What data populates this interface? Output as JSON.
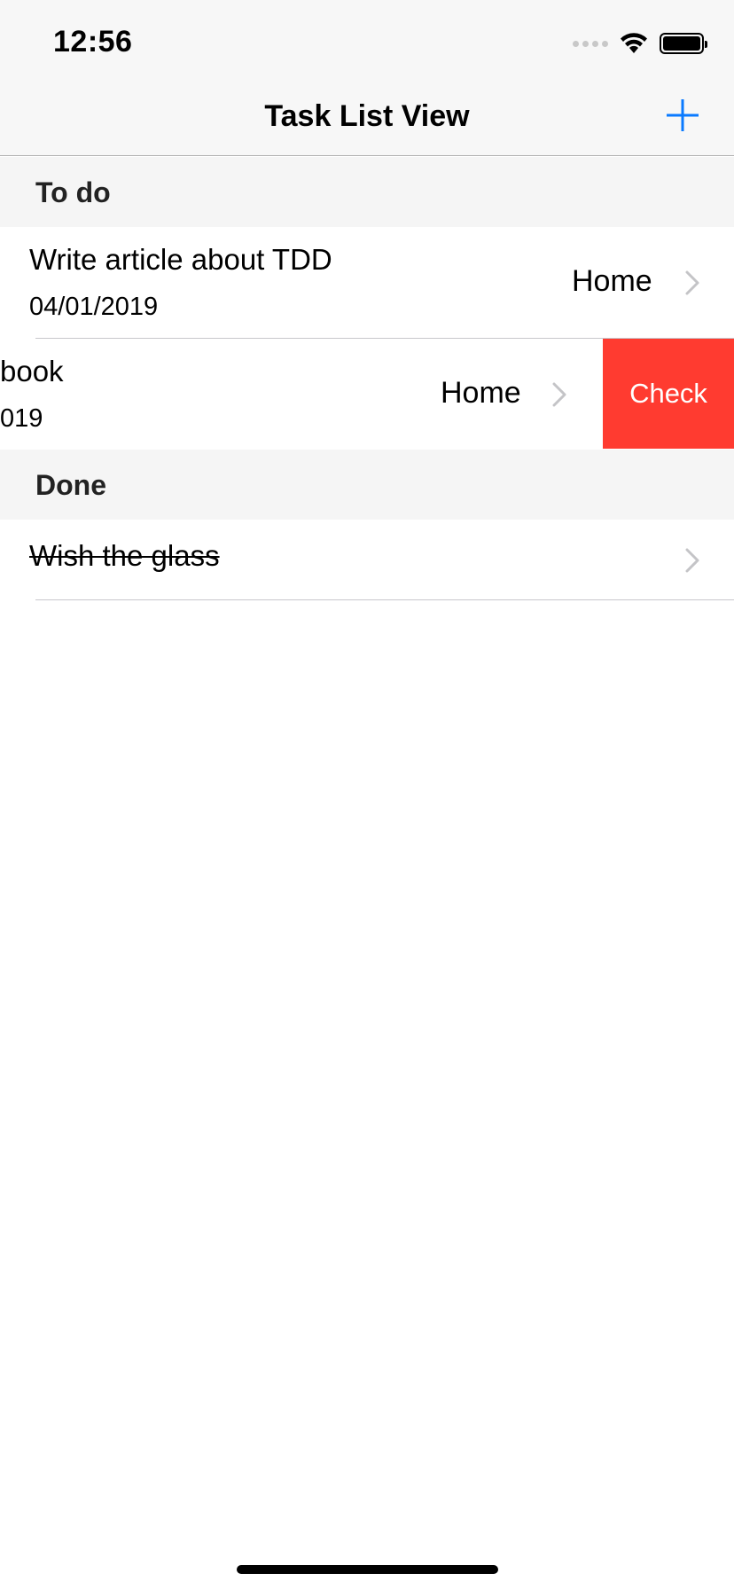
{
  "status_bar": {
    "time": "12:56",
    "icons": [
      "signal-dots-icon",
      "wifi-icon",
      "battery-icon"
    ]
  },
  "nav": {
    "title": "Task List View",
    "add_icon": "plus-icon",
    "accent_color": "#0a7aff"
  },
  "sections": [
    {
      "header": "To do",
      "rows": [
        {
          "title": "Write article about TDD",
          "date": "04/01/2019",
          "detail": "Home"
        },
        {
          "title": "book",
          "date": "019",
          "detail": "Home",
          "swiped": true
        }
      ]
    },
    {
      "header": "Done",
      "rows": [
        {
          "title": "Wish the glass",
          "strikethrough": true
        }
      ]
    }
  ],
  "swipe_action": {
    "label": "Check",
    "color": "#ff3b30"
  }
}
